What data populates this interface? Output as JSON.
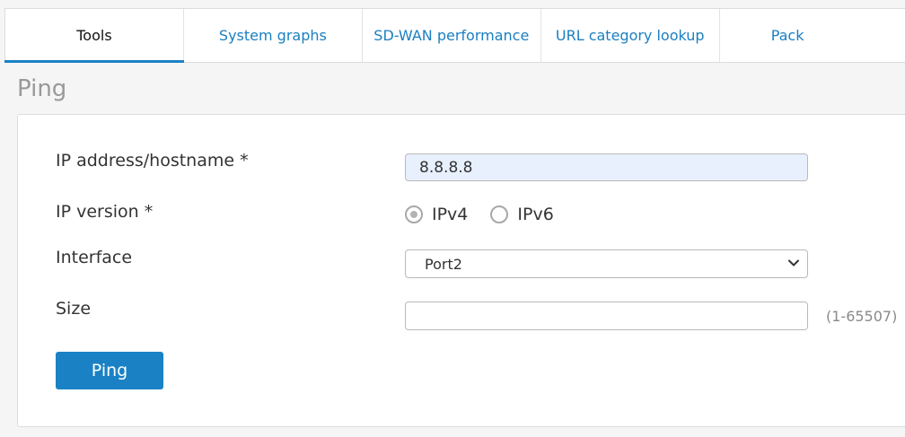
{
  "tabs": [
    {
      "label": "Tools",
      "active": true
    },
    {
      "label": "System graphs",
      "active": false
    },
    {
      "label": "SD-WAN performance",
      "active": false
    },
    {
      "label": "URL category lookup",
      "active": false
    },
    {
      "label": "Pack",
      "active": false
    }
  ],
  "page": {
    "title": "Ping"
  },
  "form": {
    "ip_label": "IP address/hostname *",
    "ip_value": "8.8.8.8",
    "version_label": "IP version *",
    "version_options": [
      "IPv4",
      "IPv6"
    ],
    "version_selected": "IPv4",
    "interface_label": "Interface",
    "interface_value": "Port2",
    "size_label": "Size",
    "size_value": "",
    "size_hint": "(1-65507)",
    "submit_label": "Ping"
  },
  "colors": {
    "accent": "#1a82c4",
    "link": "#1a7fc1",
    "autofill": "#e8f0fe"
  },
  "icons": {
    "select": "chevron-down-icon"
  }
}
